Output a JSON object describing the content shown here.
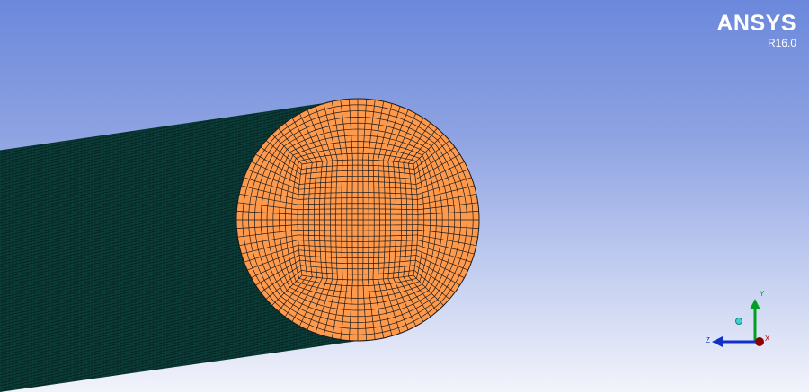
{
  "brand": {
    "name": "ANSYS",
    "version": "R16.0"
  },
  "triad": {
    "x_label": "X",
    "y_label": "Y",
    "z_label": "Z",
    "x_color": "#b00000",
    "y_color": "#00a020",
    "z_color": "#1030c8"
  },
  "mesh": {
    "face_color": "#ff9a4d",
    "body_color": "#0b3a36",
    "line_color": "#1b1b1b"
  }
}
